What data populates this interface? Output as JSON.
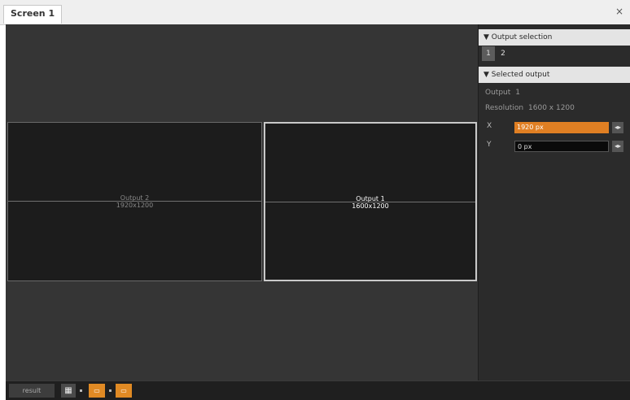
{
  "window": {
    "tab_title": "Screen 1",
    "close_glyph": "×"
  },
  "canvas": {
    "outputs": [
      {
        "name": "Output 2",
        "resolution": "1920x1200",
        "selected": false
      },
      {
        "name": "Output 1",
        "resolution": "1600x1200",
        "selected": true
      }
    ]
  },
  "panel": {
    "output_selection": {
      "header": "▼ Output selection",
      "buttons": [
        "1",
        "2"
      ],
      "active_index": 0
    },
    "selected_output": {
      "header": "▼ Selected output",
      "output_label": "Output",
      "output_value": "1",
      "resolution_label": "Resolution",
      "resolution_value": "1600 x 1200",
      "x_label": "X",
      "x_value": "1920 px",
      "y_label": "Y",
      "y_value": "0 px",
      "field_button_glyph": "◂▸"
    }
  },
  "bottombar": {
    "result_label": "result",
    "grid_glyph": "▦",
    "zoom_1_glyph": "▭",
    "zoom_2_glyph": "▭"
  },
  "colors": {
    "accent": "#e07f23",
    "background": "#2e2e2e",
    "canvas": "#353535",
    "output_fill": "#1c1c1c",
    "header_bg": "#e4e4e4"
  },
  "icons": [
    "close-icon",
    "grid-icon",
    "zoom-fit-icon",
    "zoom-actual-icon",
    "collapse-triangle-icon"
  ]
}
